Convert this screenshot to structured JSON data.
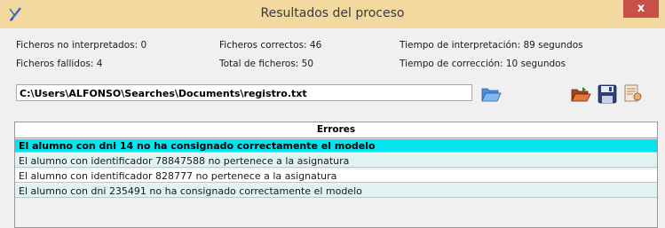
{
  "window": {
    "title": "Resultados del proceso",
    "close_label": "x"
  },
  "stats": {
    "no_interpretados": "Ficheros no interpretados: 0",
    "fallidos": "Ficheros fallidos: 4",
    "correctos": "Ficheros correctos: 46",
    "total": "Total de ficheros: 50",
    "tiempo_interpretacion": "Tiempo de interpretación: 89 segundos",
    "tiempo_correccion": "Tiempo de corrección: 10 segundos"
  },
  "path": {
    "value": "C:\\Users\\ALFONSO\\Searches\\Documents\\registro.txt"
  },
  "table": {
    "header": "Errores",
    "rows": [
      "El alumno con dni 14 no ha consignado correctamente el modelo",
      "El alumno con identificador 78847588 no pertenece a la asignatura",
      "El alumno con identificador 828777 no pertenece a la asignatura",
      "El alumno con dni 235491 no ha consignado correctamente el modelo"
    ],
    "selected_index": 0
  },
  "icons": {
    "app": "pencil-icon",
    "browse": "folder-open-icon",
    "open": "folder-open-red-icon",
    "save": "floppy-disk-icon",
    "report": "report-icon"
  },
  "colors": {
    "titlebar": "#f3d9a0",
    "close": "#c7504b",
    "selected_row": "#00e5ee",
    "alt_row": "#e0f2f2"
  }
}
